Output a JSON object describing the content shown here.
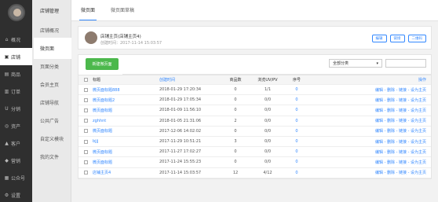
{
  "sidebar": {
    "items": [
      {
        "icon": "⌂",
        "label": "概况"
      },
      {
        "icon": "▣",
        "label": "店铺"
      },
      {
        "icon": "▤",
        "label": "商品"
      },
      {
        "icon": "▥",
        "label": "订单"
      },
      {
        "icon": "U",
        "label": "分销"
      },
      {
        "icon": "◎",
        "label": "资产"
      },
      {
        "icon": "▲",
        "label": "客户"
      },
      {
        "icon": "◆",
        "label": "营销"
      },
      {
        "icon": "▦",
        "label": "公众号"
      },
      {
        "icon": "⚙",
        "label": "设置"
      }
    ]
  },
  "subnav": {
    "title": "店铺管理",
    "items": [
      "店铺概况",
      "微页面",
      "页面分类",
      "会员主页",
      "店铺导航",
      "公共广告",
      "自定义模块",
      "我的文件"
    ]
  },
  "tabs": [
    "微页面",
    "微页面草稿"
  ],
  "store": {
    "title": "店铺主页(店铺主页4)",
    "meta": "创建时间：2017-11-14 15:03:57",
    "actions": [
      "编辑",
      "链接",
      "二维码"
    ]
  },
  "toolbar": {
    "new_button": "新建微页面",
    "filter_value": "全部分类",
    "filter_arrow": "▾"
  },
  "table": {
    "headers": [
      "标题",
      "创建时间",
      "商品数",
      "浏览UV/PV",
      "序号",
      "操作"
    ],
    "rows": [
      {
        "title": "微页面标题888",
        "time": "2018-01-29 17:20:34",
        "goods": "0",
        "uv": "1/1",
        "seq": "0",
        "ops": "编辑 - 删除 - 链接 - 设为主页"
      },
      {
        "title": "微页面标题2",
        "time": "2018-01-29 17:05:34",
        "goods": "0",
        "uv": "0/0",
        "seq": "0",
        "ops": "编辑 - 删除 - 链接 - 设为主页"
      },
      {
        "title": "微页面标题",
        "time": "2018-01-09 11:56:10",
        "goods": "0",
        "uv": "0/0",
        "seq": "0",
        "ops": "编辑 - 删除 - 链接 - 设为主页"
      },
      {
        "title": "zghhnt",
        "time": "2018-01-05 21:31:06",
        "goods": "2",
        "uv": "0/0",
        "seq": "0",
        "ops": "编辑 - 删除 - 链接 - 设为主页"
      },
      {
        "title": "微页面标题",
        "time": "2017-12-06 14:02:02",
        "goods": "0",
        "uv": "0/0",
        "seq": "0",
        "ops": "编辑 - 删除 - 链接 - 设为主页"
      },
      {
        "title": "bjjj",
        "time": "2017-11-29 10:51:21",
        "goods": "3",
        "uv": "0/0",
        "seq": "0",
        "ops": "编辑 - 删除 - 链接 - 设为主页"
      },
      {
        "title": "微页面标题",
        "time": "2017-11-27 17:02:27",
        "goods": "0",
        "uv": "0/0",
        "seq": "0",
        "ops": "编辑 - 删除 - 链接 - 设为主页"
      },
      {
        "title": "微页面标题",
        "time": "2017-11-24 15:55:23",
        "goods": "0",
        "uv": "0/0",
        "seq": "0",
        "ops": "编辑 - 删除 - 链接 - 设为主页"
      },
      {
        "title": "店铺主页4",
        "time": "2017-11-14 15:03:57",
        "goods": "12",
        "uv": "4/12",
        "seq": "0",
        "ops": "编辑 - 删除 - 链接 - 设为主页"
      }
    ]
  },
  "colors": {
    "accent": "#3388ff",
    "green": "#4cb84c",
    "sidebar": "#2f2f2f"
  }
}
